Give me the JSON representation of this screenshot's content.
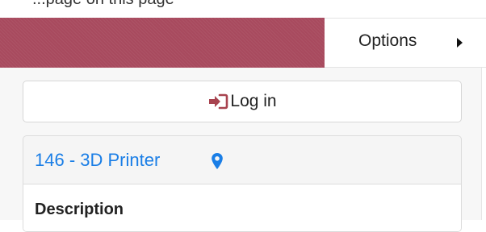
{
  "header": {
    "top_text": "...page on this page",
    "options_label": "Options",
    "brand_color": "#a84a5e"
  },
  "login": {
    "label": "Log in",
    "icon": "sign-in-icon",
    "icon_color": "#a8434f"
  },
  "item": {
    "title": "146 - 3D Printer",
    "link_color": "#1a7ee6",
    "icon": "map-marker-icon",
    "description_label": "Description"
  }
}
